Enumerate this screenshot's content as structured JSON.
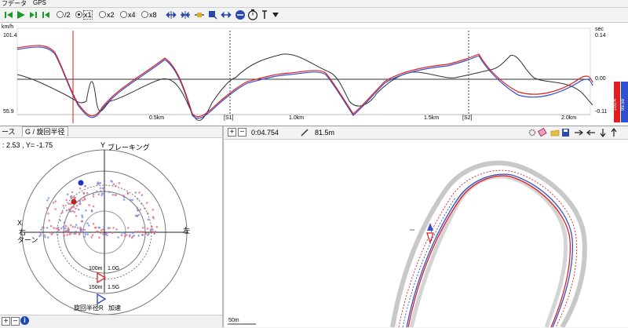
{
  "menu": {
    "items": [
      "フ",
      "データ",
      "GPS"
    ]
  },
  "toolbar": {
    "zoom_options": [
      {
        "label": "/2",
        "selected": false
      },
      {
        "label": "x1",
        "selected": true
      },
      {
        "label": "x2",
        "selected": false
      },
      {
        "label": "x4",
        "selected": false
      },
      {
        "label": "x8",
        "selected": false
      }
    ],
    "play_icons": [
      "skip-back-icon",
      "play-icon",
      "step-icon",
      "step-back-icon"
    ],
    "colors": {
      "play": "#1a9a2a",
      "speed_line_red": "#e02020",
      "speed_line_blue": "#3050d0",
      "gforce_line": "#333333"
    }
  },
  "graph": {
    "y_top_left": "101.4",
    "y_bottom_left": "55.9",
    "unit_left": "km/h",
    "unit_right": "sec",
    "y_top_right": "0.14",
    "y_mid_right": "0.00",
    "y_bottom_right": "-0.11",
    "x_ticks": [
      "0.5km",
      "[S1]",
      "1.0km",
      "1.5km",
      "[S2]",
      "2.0km"
    ],
    "legend_red": "100.4",
    "legend_blue": "99.59"
  },
  "left_panel": {
    "tab_prefix": "ース",
    "tab_label": "G / 旋回半径",
    "coords": "2.53 , Y= -1.75",
    "axis_y_label": "Y",
    "braking_label": "ブレーキング",
    "left_label_x": "X",
    "left_label_right": "右",
    "left_label_turn": "ターン",
    "right_label": "左",
    "ring_label_100m": "100m",
    "ring_label_150m": "150m",
    "ring_label_10g": "1.0G",
    "ring_label_15g": "1.5G",
    "bottom_left_label": "旋回半径R",
    "bottom_right_label": "加速"
  },
  "right_panel": {
    "time_value": "0:04.754",
    "distance_value": "81.5m",
    "scale_label": "50m"
  }
}
